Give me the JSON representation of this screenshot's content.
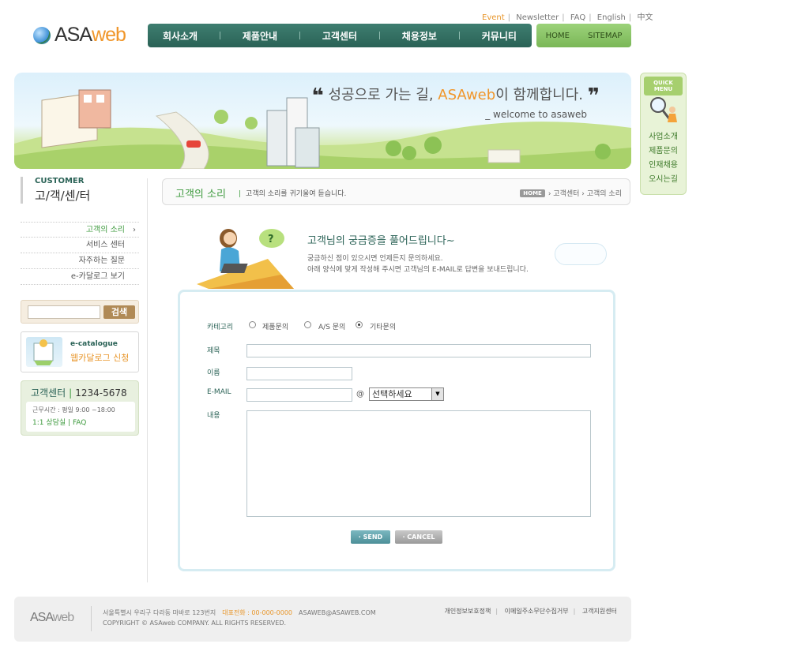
{
  "util_links": {
    "event": "Event",
    "newsletter": "Newsletter",
    "faq": "FAQ",
    "english": "English",
    "chinese": "中文"
  },
  "logo": {
    "asa": "ASA",
    "web": "web"
  },
  "nav": {
    "items": [
      "회사소개",
      "제품안내",
      "고객센터",
      "채용정보",
      "커뮤니티"
    ],
    "home": "HOME",
    "sitemap": "SITEMAP"
  },
  "banner": {
    "open_quote": "❝",
    "tagline_pre": "성공으로 가는 길, ",
    "brand": "ASAweb",
    "tagline_post": "이 함께합니다.",
    "close_quote": "❞",
    "subline": "_ welcome to asaweb"
  },
  "quick_menu": {
    "title": "QUICK MENU",
    "items": [
      "사업소개",
      "제품문의",
      "인재채용",
      "오시는길"
    ]
  },
  "sidebar": {
    "title_en": "CUSTOMER",
    "title_ko": "고/객/센/터",
    "menu": [
      "고객의 소리",
      "서비스 센터",
      "자주하는 질문",
      "e-카달로그 보기"
    ],
    "active_chevron": "›",
    "search_button": "검색",
    "ecatalogue_title": "e-catalogue",
    "ecatalogue_sub": "웹카달로그 신청",
    "cs_title": "고객센터",
    "cs_bar": "|",
    "cs_number": "1234-5678",
    "cs_hours": "근무시간 : 평일 9:00 ~18:00",
    "cs_links": "1:1 상담실  |  FAQ"
  },
  "content": {
    "title": "고객의 소리",
    "desc": "고객의 소리를 귀기울여 듣습니다.",
    "crumb_home": "HOME",
    "crumb_trail": "›  고객센터  ›  고객의 소리"
  },
  "intro": {
    "title": "고객님의 궁금증을 풀어드립니다~",
    "line1": "궁금하신 점이 있으시면 언제든지 문의하세요.",
    "line2": "아래 양식에 맞게 작성해 주시면 고객님의 E-MAIL로 답변을 보내드립니다."
  },
  "form": {
    "category_label": "카테고리",
    "radios": [
      "제품문의",
      "A/S 문의",
      "기타문의"
    ],
    "checked_index": 2,
    "subject_label": "제목",
    "name_label": "이름",
    "email_label": "E-MAIL",
    "at": "@",
    "domain_select": "선택하세요",
    "content_label": "내용",
    "send": "· SEND",
    "cancel": "· CANCEL"
  },
  "footer": {
    "logo_asa": "ASA",
    "logo_web": "web",
    "address": "서울특별시 우리구 다라동 마바로 123번지",
    "tel": "대표전화 : 00-000-0000",
    "email": "ASAWEB@ASAWEB.COM",
    "copyright": "COPYRIGHT © ASAweb COMPANY. ALL RIGHTS RESERVED.",
    "links": [
      "개인정보보호정책",
      "이메일주소무단수집거부",
      "고객지원센터"
    ]
  },
  "colors": {
    "nav_green": "#2a6256",
    "nav_light": "#7ab757",
    "accent_orange": "#e8962a",
    "accent_green": "#3e9a3e"
  }
}
